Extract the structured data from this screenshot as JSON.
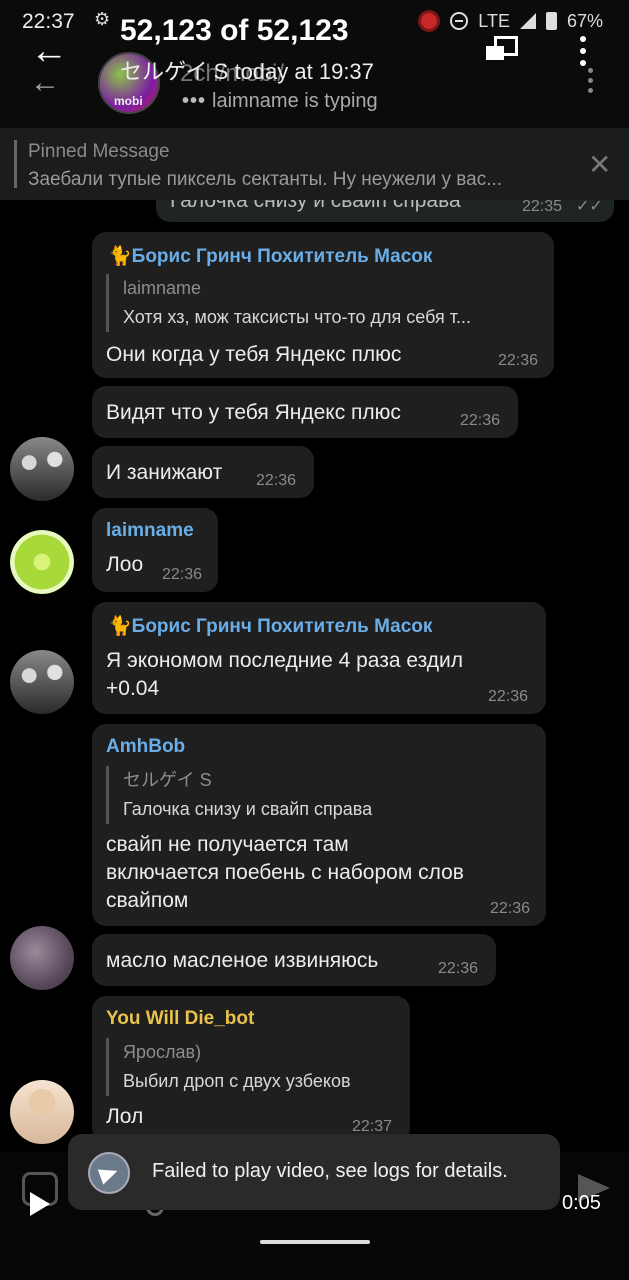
{
  "status_bar": {
    "time": "22:37",
    "network": "LTE",
    "battery": "67%"
  },
  "viewer": {
    "title": "52,123 of 52,123",
    "subtitle": "セルゲイ S today at 19:37",
    "video_time": "0:05"
  },
  "chat": {
    "name": "2ch/mobi/",
    "avatar_label": "mobi",
    "typing": "laimname is typing"
  },
  "pinned": {
    "title": "Pinned Message",
    "text": "Заебали тупые пиксель сектанты. Ну неужели у вас..."
  },
  "messages": [
    {
      "text": "Галочка снизу и свайп справа",
      "time": "22:35"
    },
    {
      "sender": "🐈Борис Гринч Похититель Масок",
      "quote_name": "laimname",
      "quote_text": "Хотя хз, мож таксисты что-то для себя т...",
      "text": "Они когда у тебя Яндекс плюс",
      "time": "22:36"
    },
    {
      "text": "Видят что у тебя Яндекс плюс",
      "time": "22:36"
    },
    {
      "text": "И занижают",
      "time": "22:36"
    },
    {
      "sender": "laimname",
      "text": "Лоо",
      "time": "22:36"
    },
    {
      "sender": "🐈Борис Гринч Похититель Масок",
      "text_line1": "Я экономом последние 4 раза ездил",
      "text_line2": "+0.04",
      "time": "22:36"
    },
    {
      "sender": "AmhBob",
      "quote_name": "セルゲイ S",
      "quote_text": "Галочка снизу и свайп справа",
      "text_line1": "свайп не получается там",
      "text_line2": "включается поебень с набором слов",
      "text_line3": "свайпом",
      "time": "22:36"
    },
    {
      "text": "масло масленое извиняюсь",
      "time": "22:36"
    },
    {
      "sender": "You Will Die_bot",
      "quote_name": "Ярослав)",
      "quote_text": "Выбил дроп с двух узбеков",
      "text": "Лол",
      "time": "22:37"
    }
  ],
  "toast": {
    "text": "Failed to play video, see logs for details."
  },
  "colors": {
    "background": "#000000",
    "bubble": "#1f1f1f",
    "sender_blue": "#6aaee8",
    "sender_yellow": "#e8c24a"
  }
}
